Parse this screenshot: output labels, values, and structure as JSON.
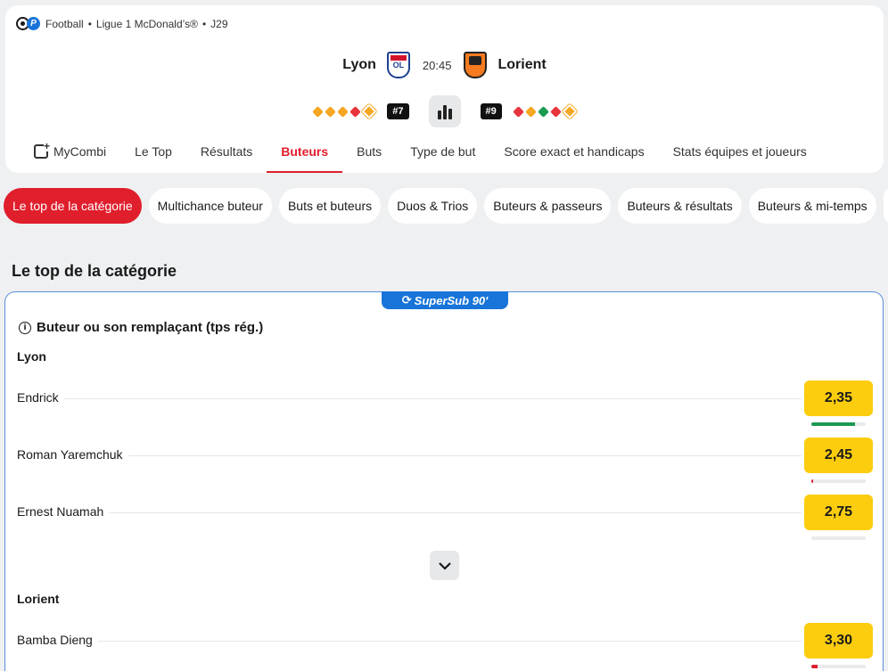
{
  "breadcrumb": {
    "sport": "Football",
    "sep1": "•",
    "league": "Ligue 1 McDonald’s®",
    "sep2": "•",
    "round": "J29"
  },
  "match": {
    "home": {
      "name": "Lyon",
      "crest_text": "OL",
      "rank": "#7",
      "form": [
        "o",
        "o",
        "o",
        "r",
        "big"
      ]
    },
    "away": {
      "name": "Lorient",
      "rank": "#9",
      "form": [
        "r",
        "o",
        "g",
        "r",
        "big"
      ]
    },
    "time": "20:45"
  },
  "tabs": [
    {
      "label": "MyCombi",
      "active": false
    },
    {
      "label": "Le Top",
      "active": false
    },
    {
      "label": "Résultats",
      "active": false
    },
    {
      "label": "Buteurs",
      "active": true
    },
    {
      "label": "Buts",
      "active": false
    },
    {
      "label": "Type de but",
      "active": false
    },
    {
      "label": "Score exact et handicaps",
      "active": false
    },
    {
      "label": "Stats équipes et joueurs",
      "active": false
    }
  ],
  "chips": [
    {
      "label": "Le top de la catégorie",
      "active": true
    },
    {
      "label": "Multichance buteur",
      "active": false
    },
    {
      "label": "Buts et buteurs",
      "active": false
    },
    {
      "label": "Duos & Trios",
      "active": false
    },
    {
      "label": "Buteurs & passeurs",
      "active": false
    },
    {
      "label": "Buteurs & résultats",
      "active": false
    },
    {
      "label": "Buteurs & mi-temps",
      "active": false
    }
  ],
  "section_title": "Le top de la catégorie",
  "market": {
    "badge": "SuperSub 90'",
    "title": "Buteur ou son remplaçant (tps rég.)",
    "groups": [
      {
        "team": "Lyon",
        "players": [
          {
            "name": "Endrick",
            "odd": "2,35",
            "trend": 0.8,
            "trend_color": "#1a9a52"
          },
          {
            "name": "Roman Yaremchuk",
            "odd": "2,45",
            "trend": 0.03,
            "trend_color": "#e01e2c"
          },
          {
            "name": "Ernest Nuamah",
            "odd": "2,75",
            "trend": 0,
            "trend_color": "#e01e2c"
          }
        ]
      },
      {
        "team": "Lorient",
        "players": [
          {
            "name": "Bamba Dieng",
            "odd": "3,30",
            "trend": 0.12,
            "trend_color": "#e01e2c"
          }
        ]
      }
    ]
  }
}
